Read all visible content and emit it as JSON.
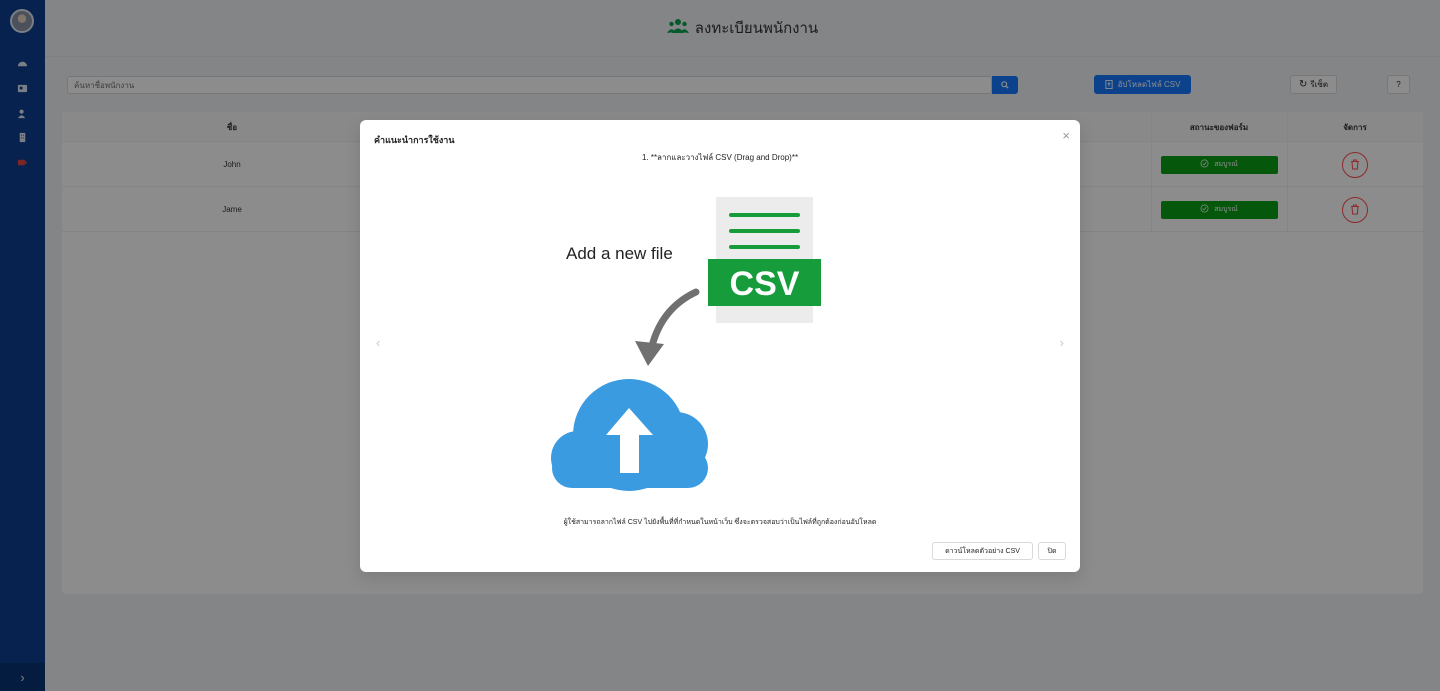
{
  "header": {
    "title": "ลงทะเบียนพนักงาน",
    "icon": "users-icon"
  },
  "toolbar": {
    "search_placeholder": "ค้นหาชื่อพนักงาน",
    "upload_label": "อัปโหลดไฟล์ CSV",
    "reset_label": "รีเซ็ต",
    "help_label": "?"
  },
  "table": {
    "columns": [
      "ชื่อ",
      "สถานะของฟอร์ม",
      "จัดการ"
    ],
    "rows": [
      {
        "name": "John",
        "status": "สมบูรณ์"
      },
      {
        "name": "Jame",
        "status": "สมบูรณ์"
      }
    ]
  },
  "modal": {
    "title": "คำแนะนำการใช้งาน",
    "step": "1. **ลากและวางไฟล์ CSV (Drag and Drop)**",
    "illustration_label": "Add a new file",
    "illustration_badge": "CSV",
    "description": "ผู้ใช้สามารถลากไฟล์ CSV ไปยังพื้นที่ที่กำหนดในหน้าเว็บ ซึ่งจะตรวจสอบว่าเป็นไฟล์ที่ถูกต้องก่อนอัปโหลด",
    "download_label": "ดาวน์โหลดตัวอย่าง CSV",
    "close_label": "ปิด",
    "prev": "‹",
    "next": "›",
    "close_icon": "×"
  },
  "colors": {
    "sidebar": "#0d3e8f",
    "primary": "#1677ff",
    "success": "#0a9e17",
    "danger": "#ff4d4f",
    "cloud": "#3a9be0",
    "csv_green": "#169c3b"
  }
}
